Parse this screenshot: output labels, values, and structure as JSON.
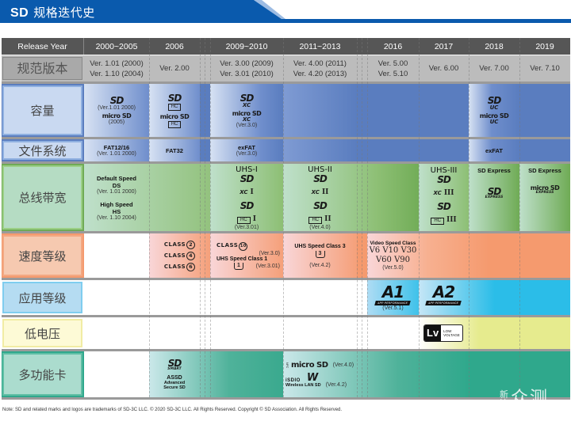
{
  "banner": {
    "title_latin": "SD",
    "title_cn": "规格迭代史",
    "color": "#0a5aad"
  },
  "header": {
    "label": "Release Year",
    "columns": [
      "2000~2005",
      "2006",
      "2009~2010",
      "2011~2013",
      "2016",
      "2017",
      "2018",
      "2019"
    ]
  },
  "rows": {
    "version": {
      "label": "规范版本",
      "cells": [
        [
          "Ver. 1.01 (2000)",
          "Ver. 1.10 (2004)"
        ],
        [
          "Ver. 2.00"
        ],
        [
          "Ver. 3.00 (2009)",
          "Ver. 3.01 (2010)"
        ],
        [
          "Ver. 4.00 (2011)",
          "Ver. 4.20 (2013)"
        ],
        [
          "Ver. 5.00",
          "Ver. 5.10"
        ],
        [
          "Ver. 6.00"
        ],
        [
          "Ver. 7.00"
        ],
        [
          "Ver. 7.10"
        ]
      ]
    },
    "capacity": {
      "label": "容量",
      "color": "#5a7dbf",
      "c2000": {
        "sd_logo": "SD",
        "sd_note": "(Ver.1.01 2000)",
        "micro_logo": "micro SD",
        "micro_note": "(2005)"
      },
      "c2006": {
        "sd_logo": "SD",
        "sd_sub": "HC",
        "micro_logo": "micro SD",
        "micro_sub": "HC"
      },
      "c2009": {
        "sd_logo": "SD",
        "sd_sub": "XC",
        "micro_logo": "micro SD",
        "micro_sub": "XC",
        "note": "(Ver.3.0)"
      },
      "c2018": {
        "sd_logo": "SD",
        "sd_sub": "UC",
        "micro_logo": "micro SD",
        "micro_sub": "UC"
      }
    },
    "filesystem": {
      "label": "文件系统",
      "c2000": {
        "name": "FAT12/16",
        "note": "(Ver. 1.01 2000)"
      },
      "c2006": {
        "name": "FAT32"
      },
      "c2009": {
        "name": "exFAT",
        "note": "(Ver.3.0)"
      },
      "c2018": {
        "name": "exFAT"
      }
    },
    "bus": {
      "label": "总线带宽",
      "color": "#72ad5a",
      "c2000": {
        "ds_title": "Default Speed",
        "ds_abbr": "DS",
        "ds_note": "(Ver. 1.01 2000)",
        "hs_title": "High Speed",
        "hs_abbr": "HS",
        "hs_note": "(Ver. 1.10 2004)"
      },
      "c2009": {
        "title": "UHS-I",
        "logo1": "SD",
        "logo1_sub": "XC",
        "logo2": "SD",
        "logo2_sub": "HC",
        "roman": "I",
        "note": "(Ver.3.01)"
      },
      "c2011": {
        "title": "UHS-II",
        "logo1": "SD",
        "logo1_sub": "XC",
        "logo2": "SD",
        "logo2_sub": "HC",
        "roman": "II",
        "note": "(Ver.4.0)"
      },
      "c2017": {
        "title": "UHS-III",
        "logo1": "SD",
        "logo1_sub": "XC",
        "logo2": "SD",
        "logo2_sub": "HC",
        "roman": "III"
      },
      "c2018": {
        "title": "SD Express",
        "logo": "SD",
        "logo_sub": "EXPRESS"
      },
      "c2019": {
        "title": "SD Express",
        "logo": "micro SD",
        "logo_sub": "EXPRESS"
      }
    },
    "speed": {
      "label": "速度等级",
      "color": "#f5a07a",
      "c2006": {
        "classes": [
          {
            "text": "CLASS",
            "num": "2"
          },
          {
            "text": "CLASS",
            "num": "4"
          },
          {
            "text": "CLASS",
            "num": "6"
          }
        ]
      },
      "c2009": {
        "class_text": "CLASS",
        "class_num": "10",
        "class_note": "(Ver.3.0)",
        "uhs_title": "UHS Speed Class 1",
        "uhs_num": "1",
        "uhs_note": "(Ver.3.01)"
      },
      "c2011": {
        "uhs_title": "UHS Speed Class 3",
        "uhs_num": "3",
        "note": "(Ver.4.2)"
      },
      "c2016": {
        "title": "Video Speed Class",
        "line1": "V6 V10 V30",
        "line2": "V60 V90",
        "note": "(Ver.5.0)"
      }
    },
    "app": {
      "label": "应用等级",
      "color": "#2bbde8",
      "c2016": {
        "logo": "A1",
        "bar": "APP PERFORMANCE",
        "note": "(Ver.5.1)"
      },
      "c2017": {
        "logo": "A2",
        "bar": "APP PERFORMANCE"
      }
    },
    "lowvolt": {
      "label": "低电压",
      "color": "#e6eb8e",
      "c2017": {
        "mark": "Lv",
        "text1": "LOW",
        "text2": "VOLTAGE"
      }
    },
    "multi": {
      "label": "多功能卡",
      "color": "#2fa88c",
      "c2006": {
        "logo": "SD",
        "logo_sub": "SMART",
        "title": "ASSD",
        "line1": "Advanced",
        "line2": "Secure SD"
      },
      "c2011": {
        "nfc_side": "NFC",
        "micro_logo": "micro SD",
        "micro_note": "(Ver.4.0)",
        "isdio": "iSDIO",
        "wifi_logo": "W",
        "wifi_caption": "Wireless LAN SD",
        "wifi_note": "(Ver.4.2)"
      }
    }
  },
  "footer": {
    "note": "Note: SD and related marks and logos are trademarks of SD-3C LLC. © 2020 SD-3C LLC. All Rights Reserved. Copyright © SD Association. All Rights Reserved."
  },
  "watermark": {
    "small": "新浪",
    "big": "众测"
  }
}
